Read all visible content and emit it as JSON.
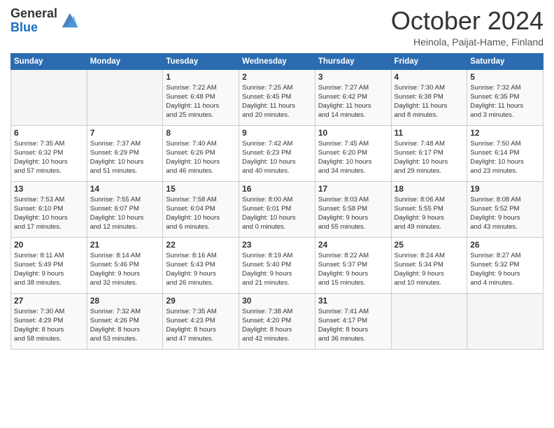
{
  "logo": {
    "general": "General",
    "blue": "Blue"
  },
  "header": {
    "month": "October 2024",
    "location": "Heinola, Paijat-Hame, Finland"
  },
  "weekdays": [
    "Sunday",
    "Monday",
    "Tuesday",
    "Wednesday",
    "Thursday",
    "Friday",
    "Saturday"
  ],
  "weeks": [
    [
      {
        "day": "",
        "info": ""
      },
      {
        "day": "",
        "info": ""
      },
      {
        "day": "1",
        "info": "Sunrise: 7:22 AM\nSunset: 6:48 PM\nDaylight: 11 hours\nand 25 minutes."
      },
      {
        "day": "2",
        "info": "Sunrise: 7:25 AM\nSunset: 6:45 PM\nDaylight: 11 hours\nand 20 minutes."
      },
      {
        "day": "3",
        "info": "Sunrise: 7:27 AM\nSunset: 6:42 PM\nDaylight: 11 hours\nand 14 minutes."
      },
      {
        "day": "4",
        "info": "Sunrise: 7:30 AM\nSunset: 6:38 PM\nDaylight: 11 hours\nand 8 minutes."
      },
      {
        "day": "5",
        "info": "Sunrise: 7:32 AM\nSunset: 6:35 PM\nDaylight: 11 hours\nand 3 minutes."
      }
    ],
    [
      {
        "day": "6",
        "info": "Sunrise: 7:35 AM\nSunset: 6:32 PM\nDaylight: 10 hours\nand 57 minutes."
      },
      {
        "day": "7",
        "info": "Sunrise: 7:37 AM\nSunset: 6:29 PM\nDaylight: 10 hours\nand 51 minutes."
      },
      {
        "day": "8",
        "info": "Sunrise: 7:40 AM\nSunset: 6:26 PM\nDaylight: 10 hours\nand 46 minutes."
      },
      {
        "day": "9",
        "info": "Sunrise: 7:42 AM\nSunset: 6:23 PM\nDaylight: 10 hours\nand 40 minutes."
      },
      {
        "day": "10",
        "info": "Sunrise: 7:45 AM\nSunset: 6:20 PM\nDaylight: 10 hours\nand 34 minutes."
      },
      {
        "day": "11",
        "info": "Sunrise: 7:48 AM\nSunset: 6:17 PM\nDaylight: 10 hours\nand 29 minutes."
      },
      {
        "day": "12",
        "info": "Sunrise: 7:50 AM\nSunset: 6:14 PM\nDaylight: 10 hours\nand 23 minutes."
      }
    ],
    [
      {
        "day": "13",
        "info": "Sunrise: 7:53 AM\nSunset: 6:10 PM\nDaylight: 10 hours\nand 17 minutes."
      },
      {
        "day": "14",
        "info": "Sunrise: 7:55 AM\nSunset: 6:07 PM\nDaylight: 10 hours\nand 12 minutes."
      },
      {
        "day": "15",
        "info": "Sunrise: 7:58 AM\nSunset: 6:04 PM\nDaylight: 10 hours\nand 6 minutes."
      },
      {
        "day": "16",
        "info": "Sunrise: 8:00 AM\nSunset: 6:01 PM\nDaylight: 10 hours\nand 0 minutes."
      },
      {
        "day": "17",
        "info": "Sunrise: 8:03 AM\nSunset: 5:58 PM\nDaylight: 9 hours\nand 55 minutes."
      },
      {
        "day": "18",
        "info": "Sunrise: 8:06 AM\nSunset: 5:55 PM\nDaylight: 9 hours\nand 49 minutes."
      },
      {
        "day": "19",
        "info": "Sunrise: 8:08 AM\nSunset: 5:52 PM\nDaylight: 9 hours\nand 43 minutes."
      }
    ],
    [
      {
        "day": "20",
        "info": "Sunrise: 8:11 AM\nSunset: 5:49 PM\nDaylight: 9 hours\nand 38 minutes."
      },
      {
        "day": "21",
        "info": "Sunrise: 8:14 AM\nSunset: 5:46 PM\nDaylight: 9 hours\nand 32 minutes."
      },
      {
        "day": "22",
        "info": "Sunrise: 8:16 AM\nSunset: 5:43 PM\nDaylight: 9 hours\nand 26 minutes."
      },
      {
        "day": "23",
        "info": "Sunrise: 8:19 AM\nSunset: 5:40 PM\nDaylight: 9 hours\nand 21 minutes."
      },
      {
        "day": "24",
        "info": "Sunrise: 8:22 AM\nSunset: 5:37 PM\nDaylight: 9 hours\nand 15 minutes."
      },
      {
        "day": "25",
        "info": "Sunrise: 8:24 AM\nSunset: 5:34 PM\nDaylight: 9 hours\nand 10 minutes."
      },
      {
        "day": "26",
        "info": "Sunrise: 8:27 AM\nSunset: 5:32 PM\nDaylight: 9 hours\nand 4 minutes."
      }
    ],
    [
      {
        "day": "27",
        "info": "Sunrise: 7:30 AM\nSunset: 4:29 PM\nDaylight: 8 hours\nand 58 minutes."
      },
      {
        "day": "28",
        "info": "Sunrise: 7:32 AM\nSunset: 4:26 PM\nDaylight: 8 hours\nand 53 minutes."
      },
      {
        "day": "29",
        "info": "Sunrise: 7:35 AM\nSunset: 4:23 PM\nDaylight: 8 hours\nand 47 minutes."
      },
      {
        "day": "30",
        "info": "Sunrise: 7:38 AM\nSunset: 4:20 PM\nDaylight: 8 hours\nand 42 minutes."
      },
      {
        "day": "31",
        "info": "Sunrise: 7:41 AM\nSunset: 4:17 PM\nDaylight: 8 hours\nand 36 minutes."
      },
      {
        "day": "",
        "info": ""
      },
      {
        "day": "",
        "info": ""
      }
    ]
  ]
}
